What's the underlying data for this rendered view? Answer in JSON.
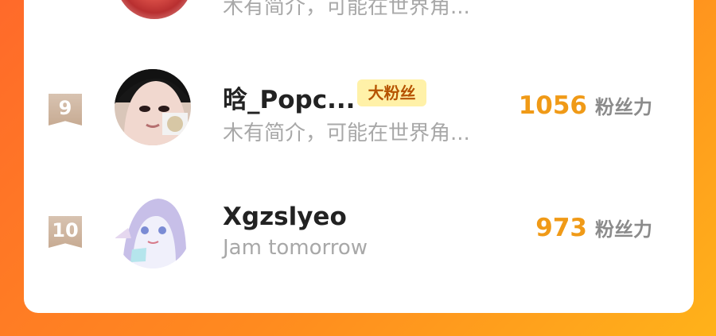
{
  "rows": [
    {
      "bio": "木有简介，可能在世界角..."
    },
    {
      "rank": "9",
      "name": "晗_Popc...",
      "badge": "大粉丝",
      "bio": "木有简介，可能在世界角...",
      "score": "1056",
      "score_label": "粉丝力"
    },
    {
      "rank": "10",
      "name": "Xgzslyeo",
      "bio": "Jam tomorrow",
      "score": "973",
      "score_label": "粉丝力"
    }
  ]
}
